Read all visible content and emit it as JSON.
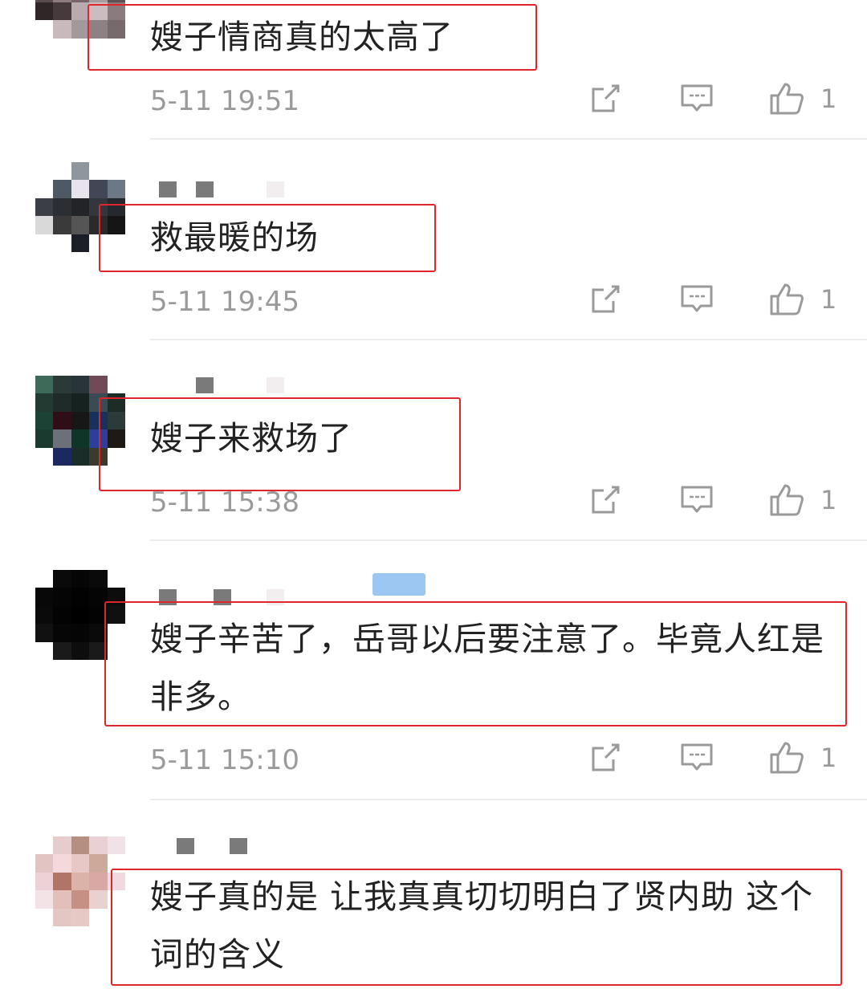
{
  "comments": [
    {
      "text": "嫂子情商真的太高了",
      "time": "5-11 19:51",
      "likes": "1"
    },
    {
      "text": "救最暖的场",
      "time": "5-11 19:45",
      "likes": "1"
    },
    {
      "text": "嫂子来救场了",
      "time": "5-11 15:38",
      "likes": "1"
    },
    {
      "text": "嫂子辛苦了，岳哥以后要注意了。毕竟人红是非多。",
      "time": "5-11 15:10",
      "likes": "1"
    },
    {
      "text": "嫂子真的是 让我真真切切明白了贤内助 这个词的含义",
      "time": "",
      "likes": ""
    }
  ],
  "icons": {
    "share": "share-icon",
    "reply": "comment-icon",
    "like": "thumbs-up-icon"
  },
  "colors": {
    "highlight_box": "#e0262b",
    "meta_text": "#9a9a9a",
    "body_text": "#222222"
  }
}
